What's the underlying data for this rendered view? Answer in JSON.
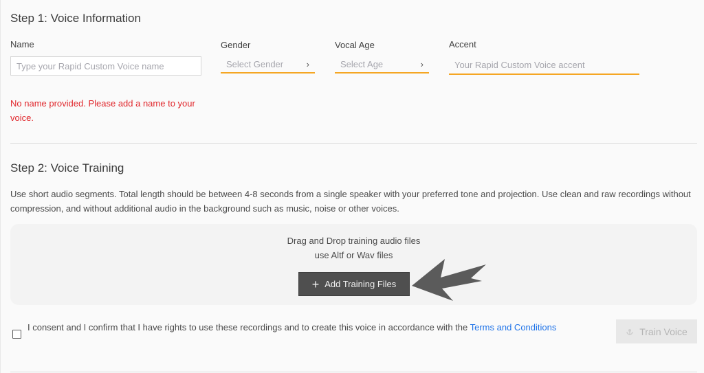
{
  "step1": {
    "title": "Step 1: Voice Information",
    "name": {
      "label": "Name",
      "placeholder": "Type your Rapid Custom Voice name",
      "value": ""
    },
    "gender": {
      "label": "Gender",
      "placeholder": "Select Gender",
      "chevron": "›"
    },
    "vocal_age": {
      "label": "Vocal Age",
      "placeholder": "Select Age",
      "chevron": "›"
    },
    "accent": {
      "label": "Accent",
      "placeholder": "Your Rapid Custom Voice accent",
      "value": ""
    },
    "error": "No name provided. Please add a name to your voice."
  },
  "step2": {
    "title": "Step 2: Voice Training",
    "description": "Use short audio segments. Total length should be between 4-8 seconds from a single speaker with your preferred tone and projection. Use clean and raw recordings without compression, and without additional audio in the background such as music, noise or other voices.",
    "dropzone": {
      "line1": "Drag and Drop training audio files",
      "line2": "use Altf or Wav files",
      "button_label": "Add Training Files",
      "button_icon": "+"
    }
  },
  "consent": {
    "checked": false,
    "text": "I consent and I confirm that I have rights to use these recordings and to create this voice in accordance with the ",
    "link_text": "Terms and Conditions"
  },
  "train_button": {
    "label": "Train Voice",
    "enabled": false
  },
  "colors": {
    "accent_underline": "#f5a623",
    "error": "#e0262b",
    "link": "#1f73e8",
    "primary_button": "#4f4f4f"
  }
}
